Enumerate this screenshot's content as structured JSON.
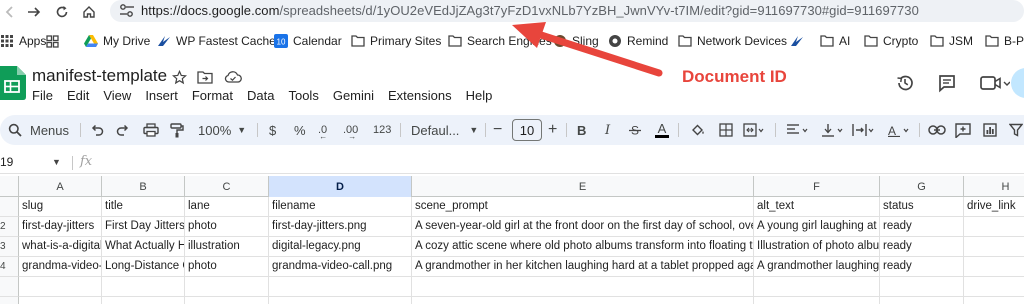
{
  "browser": {
    "url_host": "https://docs.google.com",
    "url_path": "/spreadsheets/d/1yOU2eVEdJjZAg3t7yFzD1vxNLb7YzBH_JwnVYv-t7IM/edit?gid=911697730#gid=911697730"
  },
  "bookmarks": [
    {
      "label": "Apps",
      "icon": "apps-grid-icon"
    },
    {
      "label": "",
      "icon": "tab-groups-icon"
    },
    {
      "label": "My Drive",
      "icon": "drive-icon"
    },
    {
      "label": "WP Fastest Cache",
      "icon": "wp-cache-icon"
    },
    {
      "label": "Calendar",
      "icon": "calendar-icon"
    },
    {
      "label": "Primary Sites",
      "icon": "folder-icon"
    },
    {
      "label": "Search Engines",
      "icon": "folder-icon"
    },
    {
      "label": "Sling",
      "icon": "sling-icon"
    },
    {
      "label": "Remind",
      "icon": "remind-icon"
    },
    {
      "label": "Network Devices",
      "icon": "folder-icon"
    },
    {
      "label": "",
      "icon": "wp-cache-icon"
    },
    {
      "label": "AI",
      "icon": "folder-icon"
    },
    {
      "label": "Crypto",
      "icon": "folder-icon"
    },
    {
      "label": "JSM",
      "icon": "folder-icon"
    },
    {
      "label": "B-P",
      "icon": "folder-icon"
    }
  ],
  "document": {
    "title": "manifest-template",
    "menus": [
      "File",
      "Edit",
      "View",
      "Insert",
      "Format",
      "Data",
      "Tools",
      "Gemini",
      "Extensions",
      "Help"
    ]
  },
  "toolbar": {
    "menus_label": "Menus",
    "zoom": "100%",
    "currency": "$",
    "percent": "%",
    "dec_decrease": ".0",
    "dec_increase": ".00",
    "number_format": "123",
    "font": "Defaul...",
    "font_size": "10",
    "bold": "B",
    "italic": "I",
    "text_color": "A"
  },
  "formula_bar": {
    "name_box": "19",
    "fx": "fx"
  },
  "sheet": {
    "columns": [
      "A",
      "B",
      "C",
      "D",
      "E",
      "F",
      "G",
      "H"
    ],
    "selected_column": "D",
    "row_numbers": [
      "",
      "2",
      "3",
      "4",
      "",
      ""
    ],
    "rows": [
      [
        "slug",
        "title",
        "lane",
        "filename",
        "scene_prompt",
        "alt_text",
        "status",
        "drive_link"
      ],
      [
        "first-day-jitters",
        "First Day Jitters:",
        "photo",
        "first-day-jitters.png",
        "A seven-year-old girl at the front door on the first day of school, overs",
        "A young girl laughing at t",
        "ready",
        ""
      ],
      [
        "what-is-a-digital-",
        "What Actually H",
        "illustration",
        "digital-legacy.png",
        "A cozy attic scene where old photo albums transform into floating trar",
        "Illustration of photo albun",
        "ready",
        ""
      ],
      [
        "grandma-video-c",
        "Long-Distance G",
        "photo",
        "grandma-video-call.png",
        "A grandmother in her kitchen laughing hard at a tablet propped again",
        "A grandmother laughing",
        "ready",
        ""
      ],
      [
        "",
        "",
        "",
        "",
        "",
        "",
        "",
        ""
      ],
      [
        "",
        "",
        "",
        "",
        "",
        "",
        "",
        ""
      ]
    ]
  },
  "annotation": {
    "label": "Document ID",
    "color": "#e8453c"
  },
  "colors": {
    "sheets_green": "#0f9d58",
    "toolbar_bg": "#edf2fa",
    "selected_col": "#d3e3fd",
    "share_blue": "#c2e7ff"
  }
}
